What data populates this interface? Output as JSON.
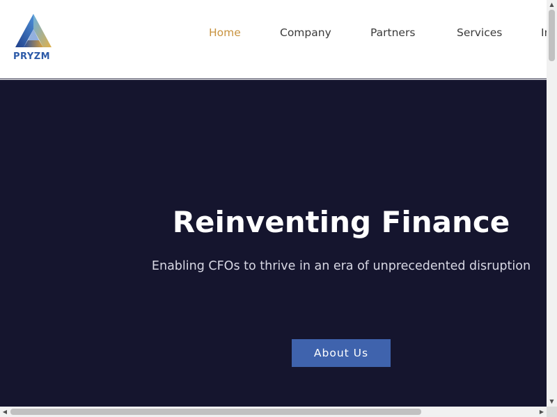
{
  "brand": {
    "name": "PRYZM",
    "logo_icon": "triangle-prism-logo",
    "colors": {
      "blue": "#2c5aa8",
      "gold": "#c8923e"
    }
  },
  "nav": {
    "items": [
      {
        "label": "Home",
        "active": true
      },
      {
        "label": "Company",
        "active": false
      },
      {
        "label": "Partners",
        "active": false
      },
      {
        "label": "Services",
        "active": false
      },
      {
        "label": "In",
        "active": false
      }
    ],
    "active_color": "#c8923e"
  },
  "hero": {
    "title": "Reinventing Finance",
    "subtitle": "Enabling CFOs to thrive in an era of unprecedented disruption",
    "button_label": "About Us",
    "background": "#15152e",
    "button_color": "#3f63ad"
  },
  "scrollbars": {
    "vertical_icons": {
      "up": "arrow-up-icon",
      "down": "arrow-down-icon"
    },
    "horizontal_icons": {
      "left": "arrow-left-icon",
      "right": "arrow-right-icon"
    }
  }
}
